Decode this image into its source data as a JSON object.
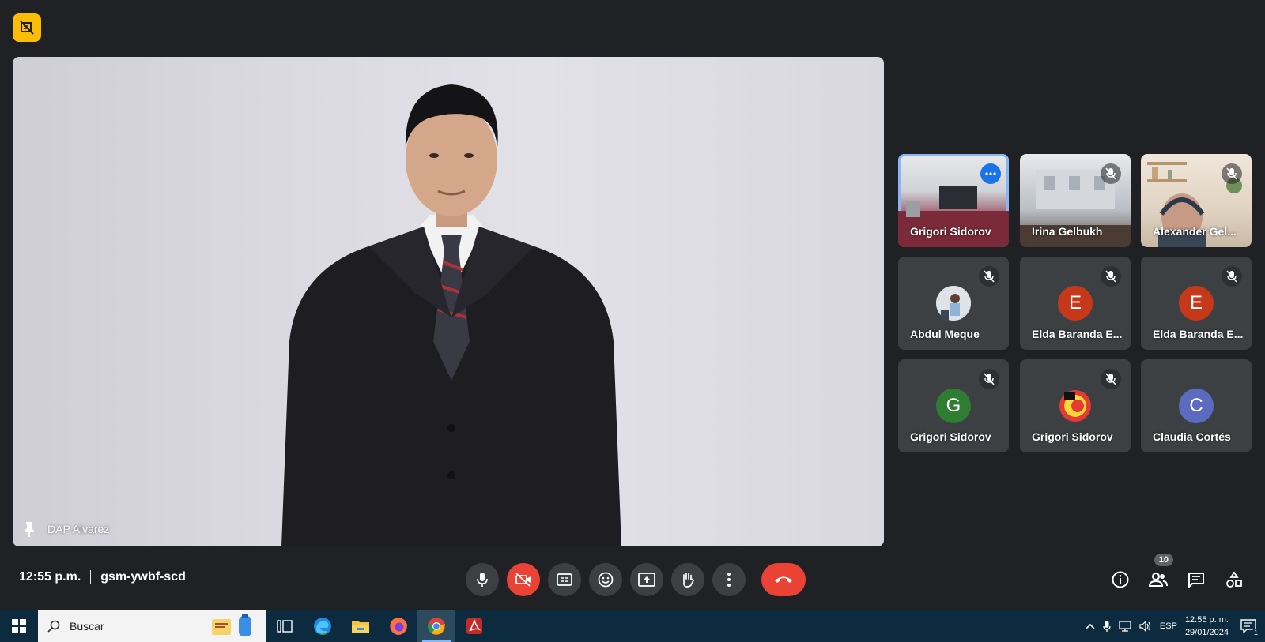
{
  "main": {
    "presenter_name": "DAP Alvarez"
  },
  "tiles": [
    {
      "name": "Grigori Sidorov",
      "type": "video",
      "active": true
    },
    {
      "name": "Irina Gelbukh",
      "type": "video",
      "muted": true
    },
    {
      "name": "Alexander Gel...",
      "type": "video",
      "muted": true
    },
    {
      "name": "Abdul Meque",
      "type": "photo",
      "muted": true
    },
    {
      "name": "Elda Baranda E...",
      "type": "letter",
      "letter": "E",
      "color": "#c5391a",
      "muted": true
    },
    {
      "name": "Elda Baranda E...",
      "type": "letter",
      "letter": "E",
      "color": "#c5391a",
      "muted": true
    },
    {
      "name": "Grigori Sidorov",
      "type": "letter",
      "letter": "G",
      "color": "#2e7d32",
      "muted": true
    },
    {
      "name": "Grigori Sidorov",
      "type": "logo",
      "muted": true
    },
    {
      "name": "Claudia Cortés",
      "type": "letter",
      "letter": "C",
      "color": "#5c6bc0",
      "muted": false
    }
  ],
  "meeting": {
    "time": "12:55 p.m.",
    "code": "gsm-ywbf-scd",
    "participants_count": "10"
  },
  "controls": [
    "mic-icon",
    "camera-off-icon",
    "captions-icon",
    "emoji-icon",
    "present-icon",
    "raise-hand-icon",
    "more-options-icon",
    "hang-up-icon"
  ],
  "right_controls": [
    "info-icon",
    "people-icon",
    "chat-icon",
    "activities-icon"
  ],
  "taskbar": {
    "search_placeholder": "Buscar",
    "language": "ESP",
    "clock_time": "12:55 p. m.",
    "clock_date": "29/01/2024",
    "notification_count": "1"
  },
  "colors": {
    "background": "#202124",
    "tile": "#3c4043",
    "danger": "#ea4335",
    "accent": "#8ab4f8",
    "record": "#fbbc04"
  }
}
